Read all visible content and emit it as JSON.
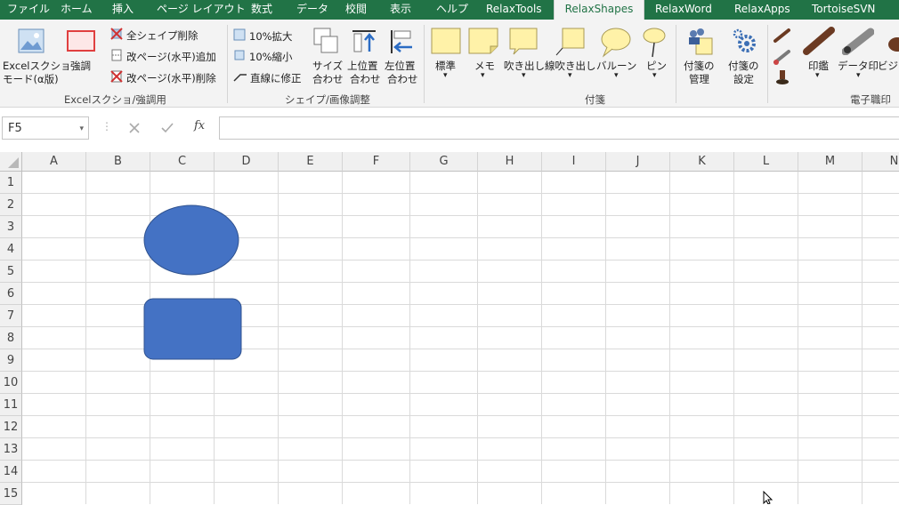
{
  "tabs": [
    "ファイル",
    "ホーム",
    "挿入",
    "ページ レイアウト",
    "数式",
    "データ",
    "校閲",
    "表示",
    "ヘルプ",
    "RelaxTools",
    "RelaxShapes",
    "RelaxWord",
    "RelaxApps",
    "TortoiseSVN"
  ],
  "active_tab": "RelaxShapes",
  "ribbon": {
    "excel_capture": {
      "line1": "Excelスクショ",
      "line2": "モード(α版)"
    },
    "emphasis": "強調",
    "delete_all_shapes": "全シェイプ削除",
    "add_page_break": "改ページ(水平)追加",
    "delete_page_break": "改ページ(水平)削除",
    "group1_label": "Excelスクショ/強調用",
    "zoom_in": "10%拡大",
    "zoom_out": "10%縮小",
    "straight_fix": "直線に修正",
    "size_fit": {
      "line1": "サイズ",
      "line2": "合わせ"
    },
    "top_fit": {
      "line1": "上位置",
      "line2": "合わせ"
    },
    "left_fit": {
      "line1": "左位置",
      "line2": "合わせ"
    },
    "group2_label": "シェイプ/画像調整",
    "standard": "標準",
    "memo": "メモ",
    "callout": "吹き出し",
    "line_callout": "線吹き出し",
    "balloon": "バルーン",
    "pin": "ピン",
    "manage": {
      "line1": "付箋の",
      "line2": "管理"
    },
    "settings": {
      "line1": "付箋の",
      "line2": "設定"
    },
    "group3_label": "付箋",
    "stamp": "印鑑",
    "data_stamp": "データ印",
    "business": "ビジネ",
    "group4_label": "電子職印"
  },
  "formula_bar": {
    "cell_ref": "F5",
    "fx": "fx",
    "value": ""
  },
  "columns": [
    "A",
    "B",
    "C",
    "D",
    "E",
    "F",
    "G",
    "H",
    "I",
    "J",
    "K",
    "L",
    "M",
    "N"
  ],
  "rows": [
    "1",
    "2",
    "3",
    "4",
    "5",
    "6",
    "7",
    "8",
    "9",
    "10",
    "11",
    "12",
    "13",
    "14",
    "15"
  ],
  "colors": {
    "green": "#217346",
    "shape_fill": "#4472c4",
    "shape_stroke": "#2f528f",
    "sticky": "#fff2a8"
  }
}
